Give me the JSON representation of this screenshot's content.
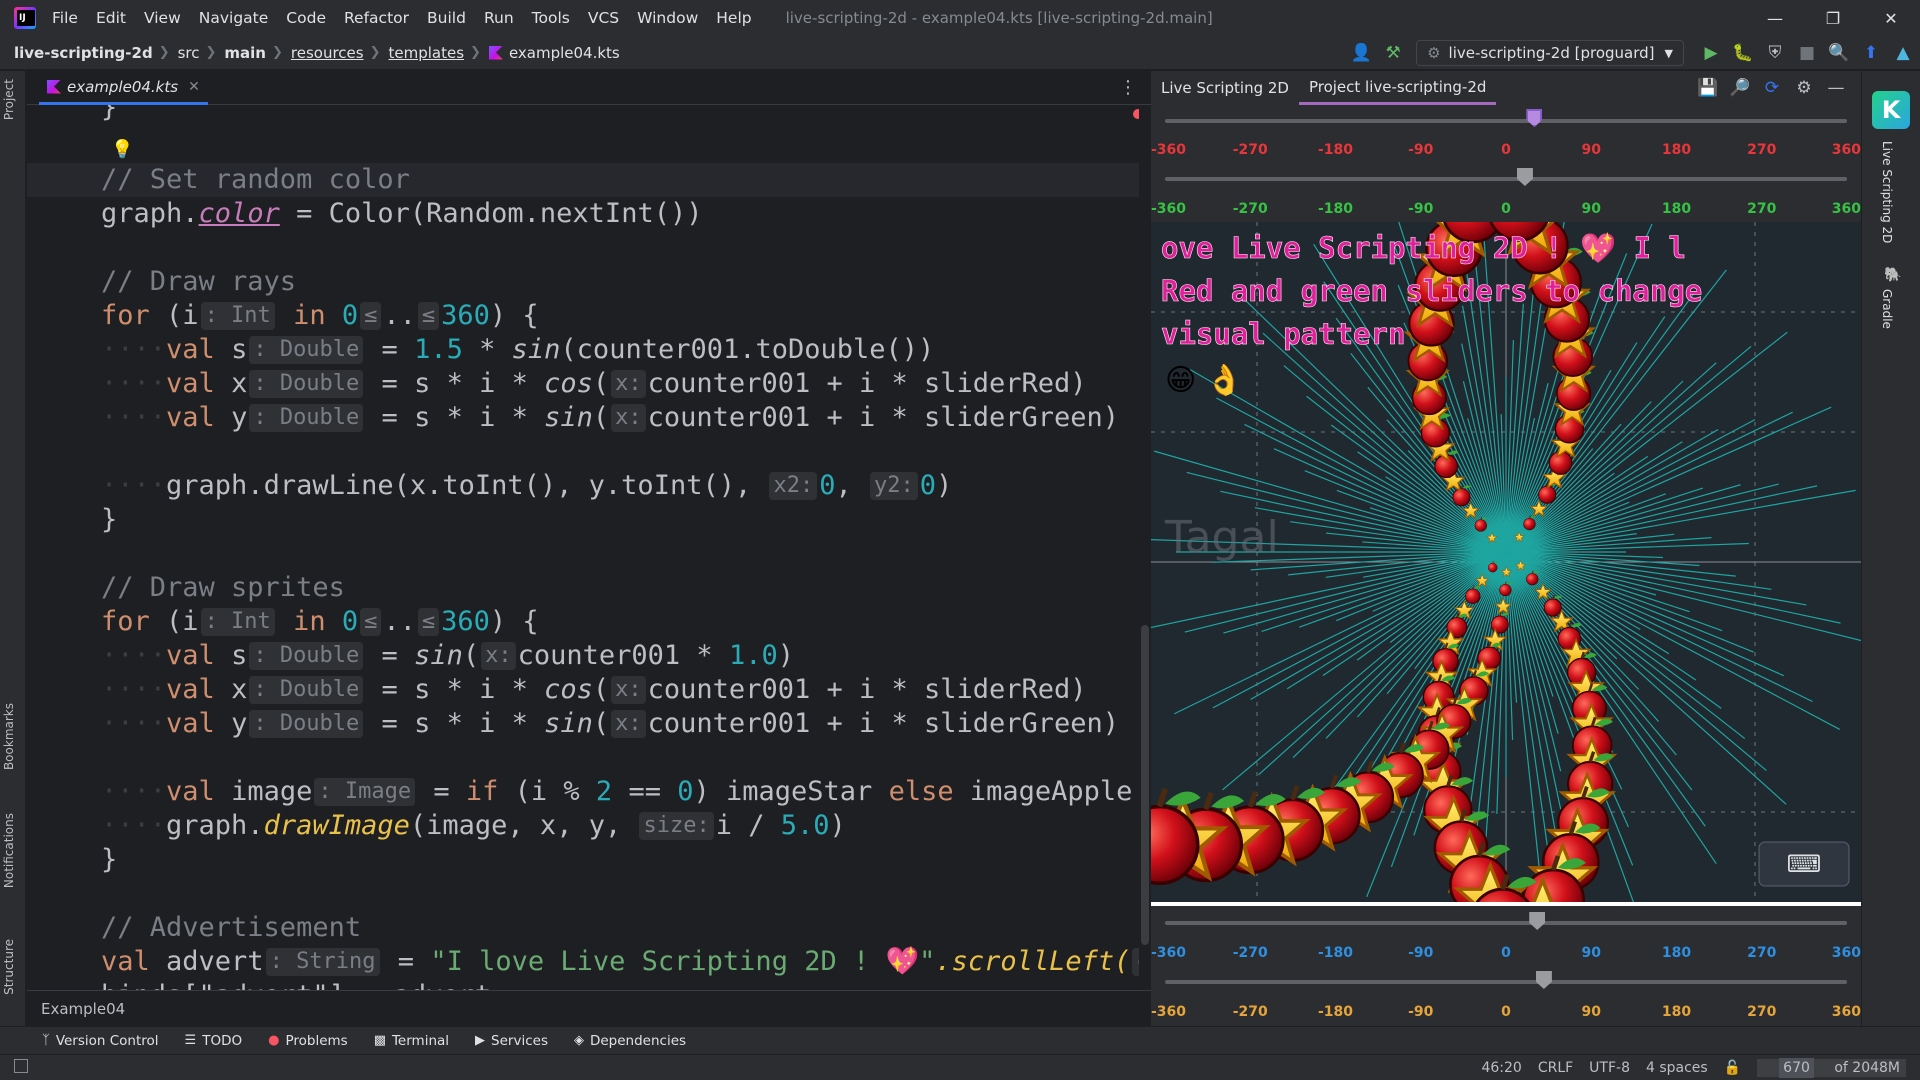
{
  "title_bar": {
    "menus": [
      "File",
      "Edit",
      "View",
      "Navigate",
      "Code",
      "Refactor",
      "Build",
      "Run",
      "Tools",
      "VCS",
      "Window",
      "Help"
    ],
    "window_title": "live-scripting-2d - example04.kts [live-scripting-2d.main]"
  },
  "nav": {
    "crumbs": [
      "live-scripting-2d",
      "src",
      "main",
      "resources",
      "templates",
      "example04.kts"
    ],
    "run_config": "live-scripting-2d [proguard]"
  },
  "left_strip": {
    "labels": [
      "Project",
      "Bookmarks",
      "Notifications",
      "Structure"
    ]
  },
  "right_strip": {
    "labels": [
      "Live Scripting 2D",
      "Gradle"
    ]
  },
  "editor": {
    "tab": "example04.kts",
    "breadcrumb": "Example04",
    "lines": {
      "l0": "}",
      "l1": "// Set random color",
      "l2a": "graph.",
      "l2b": "color",
      "l2c": " = Color(Random.nextInt())",
      "l3": "// Draw rays",
      "l4": "// Draw sprites",
      "l5": "// Advertisement",
      "l6": "binds[\"advert\"] = advert",
      "advert_str": "\"I love Live Scripting 2D ! 💖\"",
      "scroll_left": ".scrollLeft(",
      "cou": "cou"
    },
    "hints": {
      "int": ": Int",
      "double": ": Double",
      "image": ": Image",
      "string": ": String",
      "x": "x:",
      "x2": "x2:",
      "y2": "y2:",
      "size": "size:"
    }
  },
  "tool_window": {
    "tabs": [
      "Live Scripting 2D",
      "Project live-scripting-2d"
    ],
    "scale_labels": [
      "-360",
      "-270",
      "-180",
      "-90",
      "0",
      "90",
      "180",
      "270",
      "360"
    ],
    "sliders": {
      "top_1": 30,
      "top_2": 20,
      "bottom_1": 33,
      "bottom_2": 40
    },
    "canvas": {
      "marquee_line1": "ove Live Scripting 2D ! 💖 I l",
      "marquee_line2": "Red and green sliders to change",
      "marquee_line3": "visual pattern",
      "emojis": "😁 👌",
      "ghost_text": "Tagal",
      "marquee_color": "#e0209a"
    }
  },
  "bottom_tools": [
    "Version Control",
    "TODO",
    "Problems",
    "Terminal",
    "Services",
    "Dependencies"
  ],
  "status": {
    "position": "46:20",
    "line_sep": "CRLF",
    "encoding": "UTF-8",
    "indent": "4 spaces",
    "memory_used": "670",
    "memory_total": "of 2048M"
  }
}
